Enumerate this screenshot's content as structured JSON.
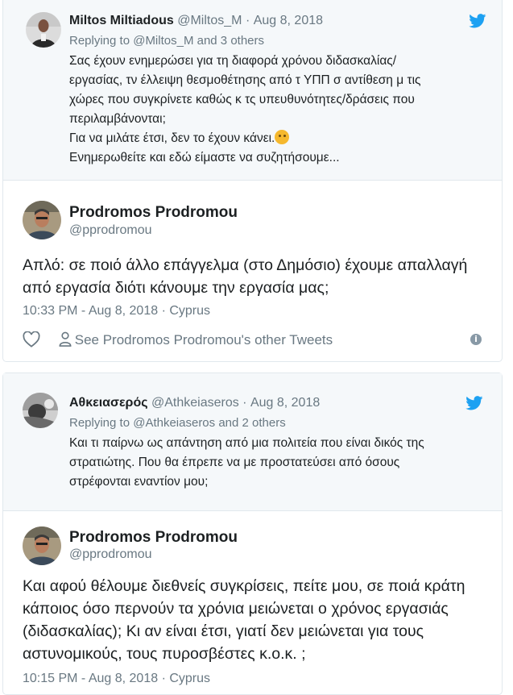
{
  "tweet1": {
    "quoted": {
      "name": "Miltos Miltiadous",
      "handle": "@Miltos_M",
      "sep": "·",
      "date": "Aug 8, 2018",
      "replying": "Replying to @Miltos_M and 3 others",
      "lines": [
        "Σας έχουν ενημερώσει για τη διαφορά χρόνου διδασκαλίας/",
        "εργασίας, τν έλλειψη θεσμοθέτησης από τ ΥΠΠ σ αντίθεση μ τις",
        "χώρες που συγκρίνετε καθώς κ τς υπευθυνότητες/δράσεις που",
        "περιλαμβάνονται;",
        "Για να μιλάτε έτσι, δεν το έχουν κάνει.",
        "Ενημερωθείτε και εδώ είμαστε να συζητήσουμε..."
      ]
    },
    "main": {
      "name": "Prodromos Prodromou",
      "handle": "@pprodromou",
      "lines": [
        "Απλό: σε ποιό άλλο επάγγελμα (στο Δημόσιο) έχουμε απαλλαγή",
        "από εργασία διότι κάνουμε την εργασία μας;"
      ],
      "meta": "10:33 PM - Aug 8, 2018 · Cyprus",
      "see_more": "See Prodromos Prodromou's other Tweets"
    }
  },
  "tweet2": {
    "quoted": {
      "name": "Αθκειασερός",
      "handle": "@Athkeiaseros",
      "sep": "·",
      "date": "Aug 8, 2018",
      "replying": "Replying to @Athkeiaseros and 2 others",
      "lines": [
        "Και τι παίρνω ως απάντηση από μια πολιτεία που είναι δικός της",
        "στρατιώτης. Που θα έπρεπε να με προστατεύσει από όσους",
        "στρέφονται εναντίον μου;"
      ]
    },
    "main": {
      "name": "Prodromos Prodromou",
      "handle": "@pprodromou",
      "lines": [
        "Και αφού θέλουμε διεθνείς συγκρίσεις, πείτε μου, σε ποιά κράτη",
        "κάποιος όσο περνούν τα χρόνια μειώνεται ο χρόνος εργασιάς",
        "(διδασκαλίας); Κι αν είναι έτσι, γιατί δεν μειώνεται για τους",
        "αστυνομικούς, τους πυροσβέστες κ.ο.κ. ;"
      ],
      "meta": "10:15 PM - Aug 8, 2018 · Cyprus"
    }
  },
  "colors": {
    "accent": "#1da1f2",
    "meta": "#697882",
    "quote_bg": "#f5f8fa"
  },
  "icons": [
    "twitter-bird-icon",
    "heart-icon",
    "person-icon",
    "info-icon",
    "thinking-face-emoji"
  ]
}
